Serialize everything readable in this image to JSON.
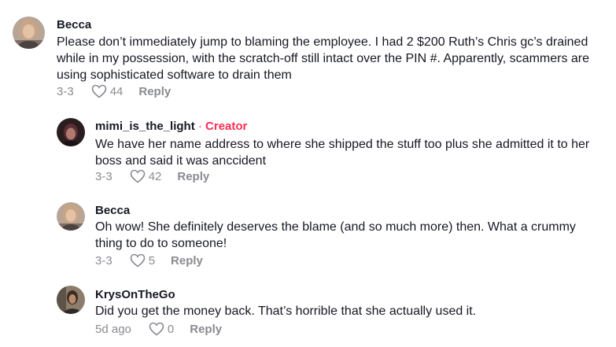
{
  "comments": [
    {
      "author": "Becca",
      "text": "Please don’t immediately jump to blaming the employee. I had 2 $200 Ruth’s Chris gc’s drained while in my possession, with the scratch-off still intact over the PIN #. Apparently, scammers are using sophisticated software to drain them",
      "date": "3-3",
      "likes": "44",
      "reply": "Reply"
    },
    {
      "author": "mimi_is_the_light",
      "badge_sep": "·",
      "badge": "Creator",
      "text": "We have her name address to where she shipped the stuff too plus she admitted it to her boss and said it was anccident",
      "date": "3-3",
      "likes": "42",
      "reply": "Reply"
    },
    {
      "author": "Becca",
      "text": "Oh wow! She definitely deserves the blame (and so much more) then. What a crummy thing to do to someone!",
      "date": "3-3",
      "likes": "5",
      "reply": "Reply"
    },
    {
      "author": "KrysOnTheGo",
      "text": "Did you get the money back. That’s horrible that she actually used it.",
      "date": "5d ago",
      "likes": "0",
      "reply": "Reply"
    }
  ],
  "colors": {
    "creator": "#fe2c55",
    "meta": "#8a8b91",
    "text": "#161823"
  },
  "icons": {
    "like": "heart-outline-icon"
  }
}
